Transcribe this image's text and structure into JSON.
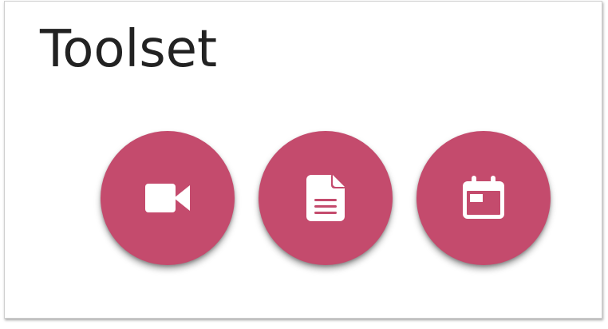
{
  "card": {
    "title": "Toolset"
  },
  "buttons": [
    {
      "icon": "video-camera-icon"
    },
    {
      "icon": "document-icon"
    },
    {
      "icon": "calendar-icon"
    }
  ],
  "colors": {
    "fab": "#c44b6d",
    "icon": "#ffffff",
    "title": "#222222"
  }
}
